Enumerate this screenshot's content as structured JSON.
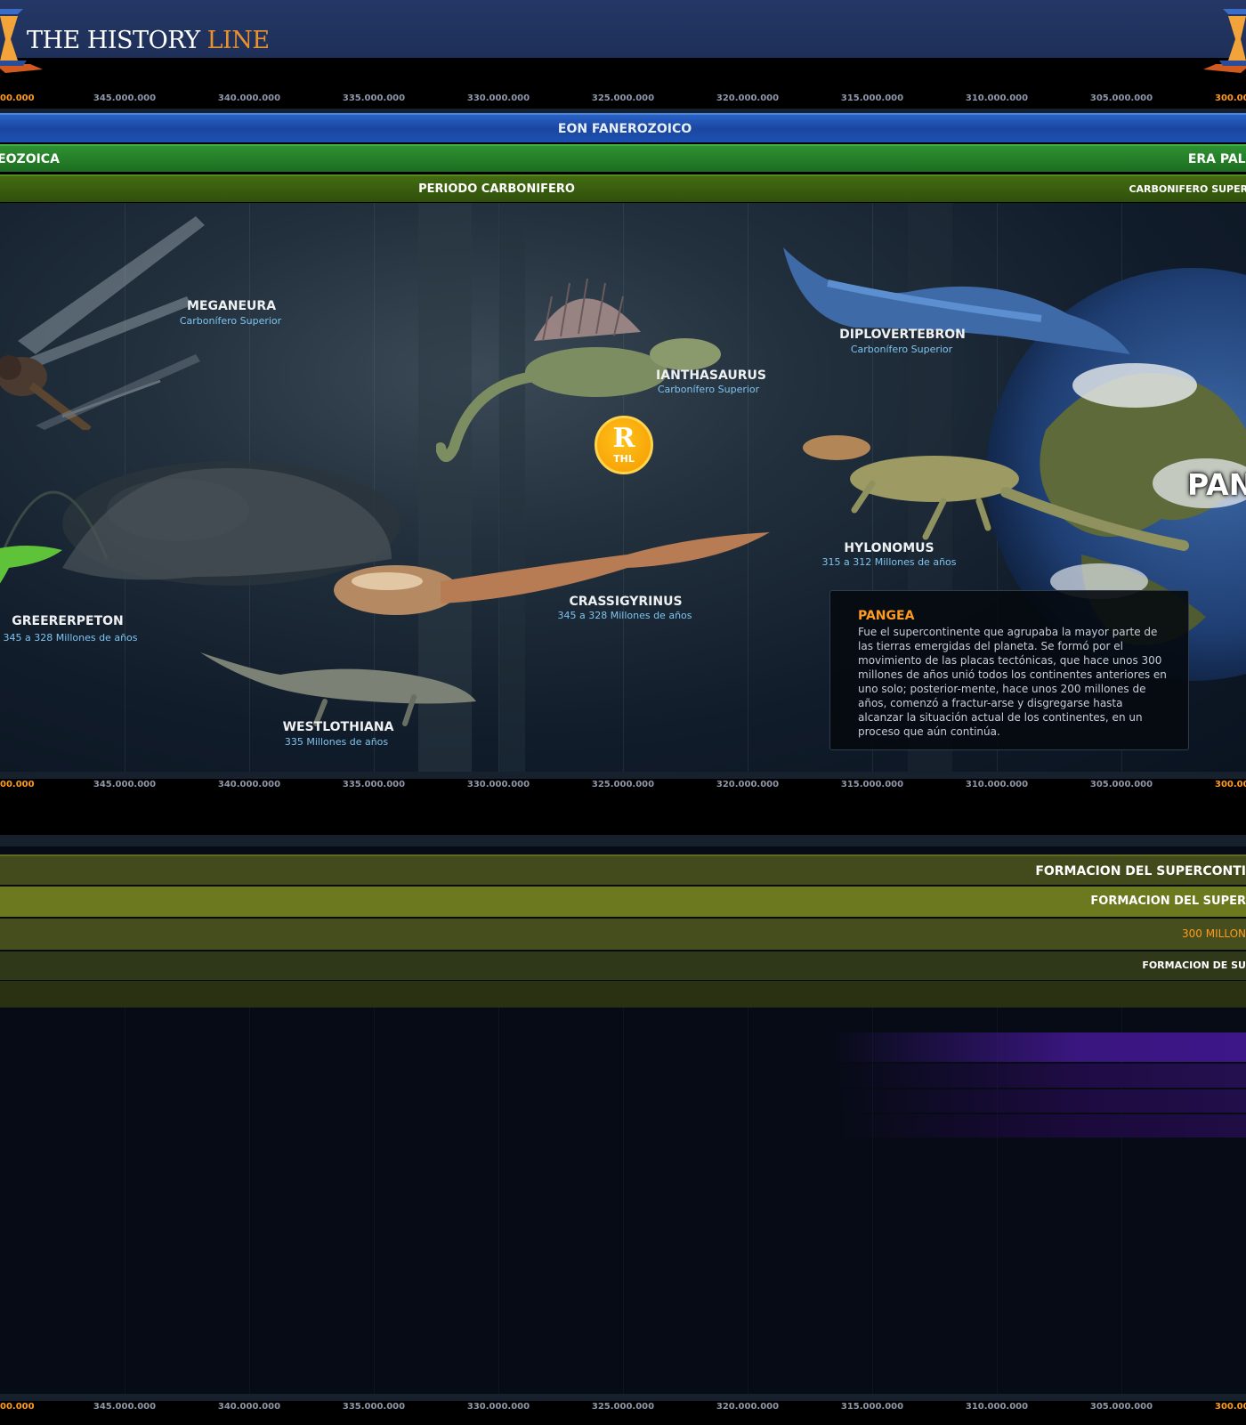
{
  "header": {
    "logo_text_main": "THE HISTORY ",
    "logo_text_accent": "LINE",
    "brand_color": "#243766",
    "accent_color": "#e8912f"
  },
  "ruler": {
    "left_edge": "00.000",
    "ticks": [
      "345.000.000",
      "340.000.000",
      "335.000.000",
      "330.000.000",
      "325.000.000",
      "320.000.000",
      "315.000.000",
      "310.000.000",
      "305.000.000"
    ],
    "right_edge": "300.00"
  },
  "bands": {
    "eon": "EON FANEROZOICO",
    "era_left": "EOZOICA",
    "era_right": "ERA PALE",
    "period": "PERIODO CARBONIFERO",
    "period_right": "CARBONIFERO SUPERIO"
  },
  "creatures": [
    {
      "name": "MEGANEURA",
      "sub": "Carbonífero Superior"
    },
    {
      "name": "IANTHASAURUS",
      "sub": "Carbonífero Superior"
    },
    {
      "name": "DIPLOVERTEBRON",
      "sub": "Carbonífero Superior"
    },
    {
      "name": "HYLONOMUS",
      "sub": "315 a 312 Millones de años"
    },
    {
      "name": "CRASSIGYRINUS",
      "sub": "345 a 328 Millones de años"
    },
    {
      "name": "GREERERPETON",
      "sub": "345 a 328 Millones de años"
    },
    {
      "name": "WESTLOTHIANA",
      "sub": "335 Millones de años"
    }
  ],
  "badge": {
    "letter": "R",
    "caption": "THL"
  },
  "pangea": {
    "label": "PAN",
    "title": "PANGEA",
    "text": "Fue el supercontinente que agrupaba la mayor parte de las tierras emergidas del planeta. Se formó por el movimiento de las placas tectónicas, que hace unos 300 millones de años unió todos los continentes anteriores en uno solo; posterior-mente, hace unos 200 millones de años, comenzó a fractur-arse y disgregarse hasta alcanzar la situación actual de los continentes, en un proceso que aún continúa."
  },
  "lower_bands": {
    "b1": "FORMACION DEL SUPERCONTI",
    "b2": "FORMACION DEL SUPER",
    "b3": "300 MILLON",
    "b4": "FORMACION DE SU"
  }
}
